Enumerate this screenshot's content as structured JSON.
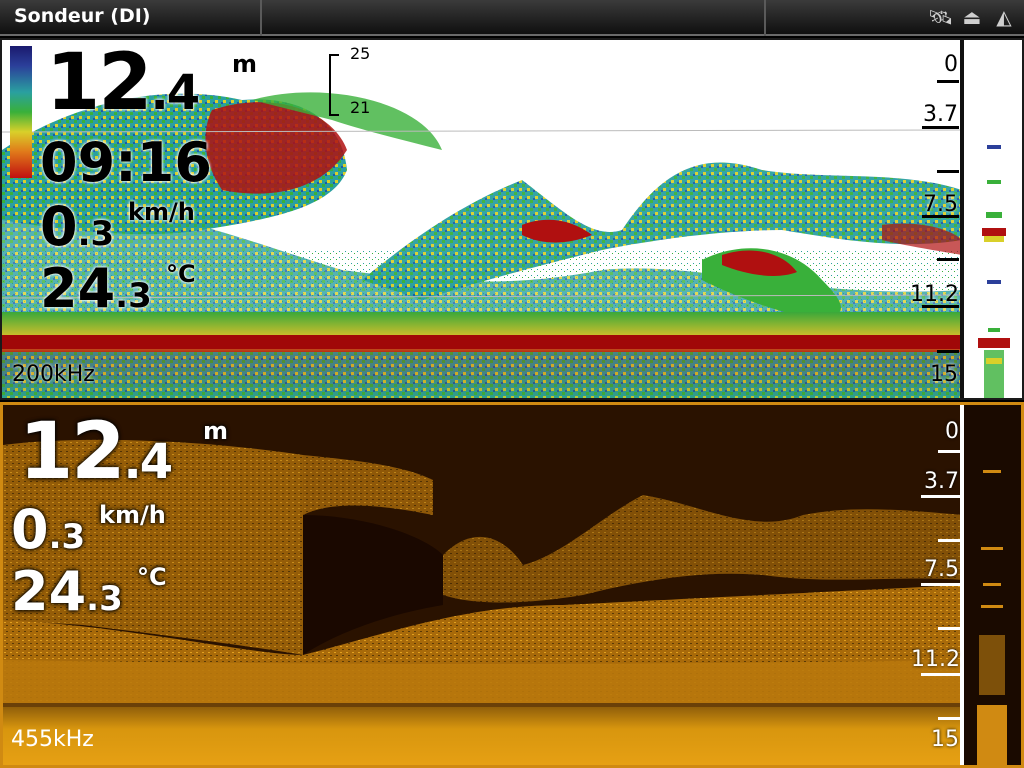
{
  "window": {
    "title": "Sondeur (DI)"
  },
  "status_icons": [
    "satellite-icon",
    "sonar-transducer-icon",
    "compass-icon"
  ],
  "top_panel": {
    "depth": {
      "int": "12",
      "dec": ".4",
      "unit": "m"
    },
    "time": "09:16",
    "speed": {
      "int": "0",
      "dec": ".3",
      "unit": "km/h"
    },
    "temperature": {
      "int": "24",
      "dec": ".3",
      "unit": "°C"
    },
    "zoom": {
      "upper": "25",
      "lower": "21"
    },
    "frequency": "200kHz",
    "depth_scale": [
      "0",
      "3.7",
      "7.5",
      "11.2",
      "15"
    ]
  },
  "bottom_panel": {
    "depth": {
      "int": "12",
      "dec": ".4",
      "unit": "m"
    },
    "speed": {
      "int": "0",
      "dec": ".3",
      "unit": "km/h"
    },
    "temperature": {
      "int": "24",
      "dec": ".3",
      "unit": "°C"
    },
    "frequency": "455kHz",
    "depth_scale": [
      "0",
      "3.7",
      "7.5",
      "11.2",
      "15"
    ]
  },
  "colors": {
    "accent_orange": "#d08a12",
    "sonar_red": "#b01010",
    "sonar_green": "#3aa83a",
    "di_amber": "#e6a014"
  }
}
